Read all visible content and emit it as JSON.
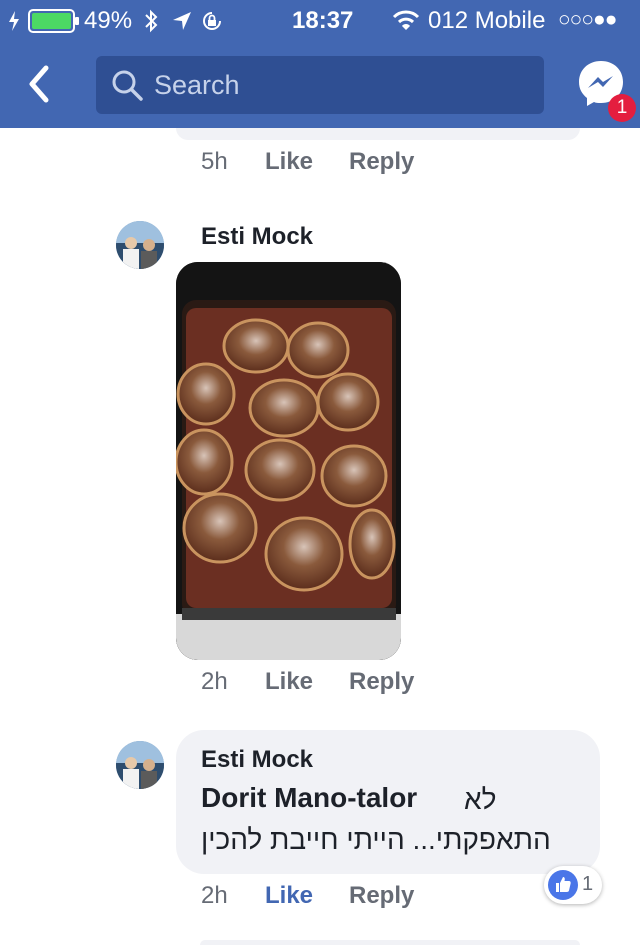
{
  "status_bar": {
    "battery": "49%",
    "time": "18:37",
    "carrier": "012 Mobile",
    "signal_dots": "○○○●●"
  },
  "header": {
    "search_placeholder": "Search",
    "messenger_badge": "1"
  },
  "colors": {
    "brand": "#4267b2",
    "like_active": "#4267b2",
    "badge": "#e41e3f"
  },
  "comments": [
    {
      "time": "5h",
      "like": "Like",
      "reply": "Reply"
    },
    {
      "author": "Esti Mock",
      "has_photo": true,
      "time": "2h",
      "like": "Like",
      "reply": "Reply"
    },
    {
      "author": "Esti Mock",
      "mention": "Dorit Mano-talor",
      "text_line1": "לא",
      "text_line2": "התאפקתי... הייתי חייבת להכין",
      "time": "2h",
      "like": "Like",
      "reply": "Reply",
      "reaction_count": "1"
    }
  ]
}
